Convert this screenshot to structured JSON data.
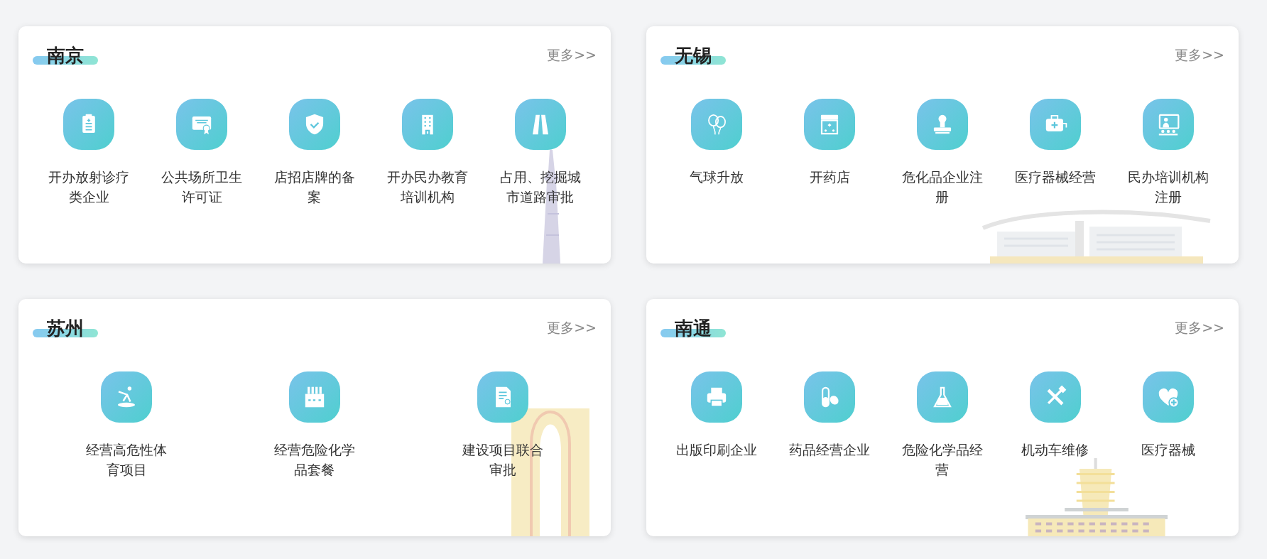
{
  "cards": [
    {
      "title": "南京",
      "more": "更多>>",
      "kind": "tower",
      "items": [
        {
          "label": "开办放射诊疗类企业",
          "kind": "clipboard"
        },
        {
          "label": "公共场所卫生许可证",
          "kind": "certificate"
        },
        {
          "label": "店招店牌的备案",
          "kind": "shield"
        },
        {
          "label": "开办民办教育培训机构",
          "kind": "building"
        },
        {
          "label": "占用、挖掘城市道路审批",
          "kind": "road"
        }
      ]
    },
    {
      "title": "无锡",
      "more": "更多>>",
      "kind": "hall",
      "items": [
        {
          "label": "气球升放",
          "kind": "balloon"
        },
        {
          "label": "开药店",
          "kind": "shop"
        },
        {
          "label": "危化品企业注册",
          "kind": "stamp"
        },
        {
          "label": "医疗器械经营",
          "kind": "kit"
        },
        {
          "label": "民办培训机构注册",
          "kind": "teacher"
        }
      ]
    },
    {
      "title": "苏州",
      "more": "更多>>",
      "kind": "gate",
      "items": [
        {
          "label": "经营高危性体育项目",
          "kind": "skater"
        },
        {
          "label": "经营危险化学品套餐",
          "kind": "factory"
        },
        {
          "label": "建设项目联合审批",
          "kind": "document"
        }
      ]
    },
    {
      "title": "南通",
      "more": "更多>>",
      "kind": "pagoda",
      "items": [
        {
          "label": "出版印刷企业",
          "kind": "printer"
        },
        {
          "label": "药品经营企业",
          "kind": "pill"
        },
        {
          "label": "危险化学品经营",
          "kind": "flask"
        },
        {
          "label": "机动车维修",
          "kind": "tools"
        },
        {
          "label": "医疗器械",
          "kind": "heart"
        }
      ]
    }
  ]
}
